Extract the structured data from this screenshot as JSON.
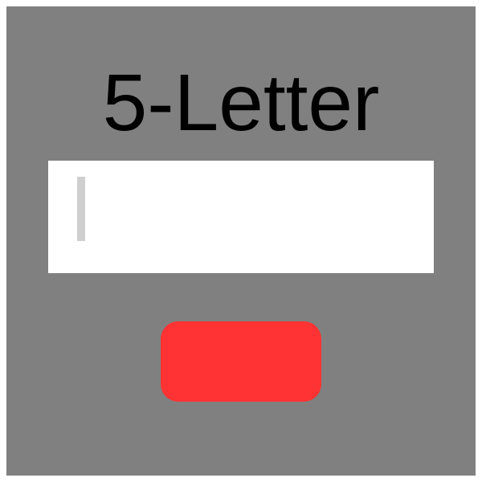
{
  "app": {
    "title": "5-Letter"
  },
  "input": {
    "value": "",
    "placeholder": ""
  },
  "submit": {
    "label": ""
  },
  "colors": {
    "background": "#808080",
    "input_background": "#ffffff",
    "caret": "#cfcfcf",
    "button": "#ff3333",
    "title_text": "#000000"
  }
}
